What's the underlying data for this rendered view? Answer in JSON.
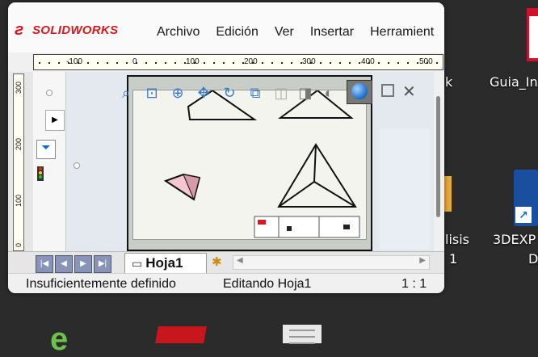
{
  "app": {
    "brand": "SOLIDWORKS",
    "brand_color": "#d91920"
  },
  "menu": [
    "Archivo",
    "Edición",
    "Ver",
    "Insertar",
    "Herramient"
  ],
  "ruler": {
    "labels": [
      "-100",
      "0",
      "100",
      "200",
      "300",
      "400",
      "500"
    ]
  },
  "vruler": {
    "labels": [
      "300",
      "200",
      "100",
      "0"
    ]
  },
  "sheet_tab": {
    "label": "Hoja1"
  },
  "status": {
    "definition": "Insuficientemente definido",
    "editing": "Editando Hoja1",
    "scale": "1 : 1"
  },
  "desktop": {
    "icons": [
      {
        "label": "Guia_In",
        "icon": "pdf-file-icon"
      },
      {
        "label": "3DEXP",
        "icon": "shortcut-icon"
      },
      {
        "label": "D",
        "icon": "shortcut-icon"
      },
      {
        "label": "k",
        "icon": "file-icon"
      },
      {
        "label": "lisis",
        "icon": "file-icon"
      },
      {
        "label": "1",
        "icon": "file-icon"
      }
    ]
  },
  "toolbar_icons": [
    "zoom-to-fit-icon",
    "zoom-area-icon",
    "zoom-in-out-icon",
    "pan-icon",
    "rotate-icon",
    "view-orientation-icon",
    "display-style-icon",
    "section-view-icon",
    "appearance-icon"
  ]
}
